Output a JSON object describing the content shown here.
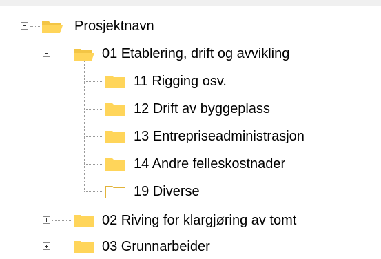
{
  "tree": {
    "root": {
      "label": "Prosjektnavn",
      "expanded": true,
      "icon": "folder-open-icon"
    },
    "nodes": [
      {
        "label": "01 Etablering, drift og avvikling",
        "expanded": true,
        "icon": "folder-open-icon",
        "children": [
          {
            "label": "11 Rigging osv.",
            "icon": "folder-icon"
          },
          {
            "label": "12 Drift av byggeplass",
            "icon": "folder-icon"
          },
          {
            "label": "13 Entrepriseadministrasjon",
            "icon": "folder-icon"
          },
          {
            "label": "14 Andre felleskostnader",
            "icon": "folder-icon"
          },
          {
            "label": "19 Diverse",
            "icon": "folder-empty-icon"
          }
        ]
      },
      {
        "label": "02 Riving for klargjøring av tomt",
        "expanded": false,
        "icon": "folder-icon"
      },
      {
        "label": "03 Grunnarbeider",
        "expanded": false,
        "icon": "folder-icon"
      }
    ]
  },
  "colors": {
    "folder_fill": "#ffd55a",
    "folder_empty_fill": "#ffffff",
    "folder_outline": "#e2b33a",
    "tree_line": "#9a9a9a"
  }
}
